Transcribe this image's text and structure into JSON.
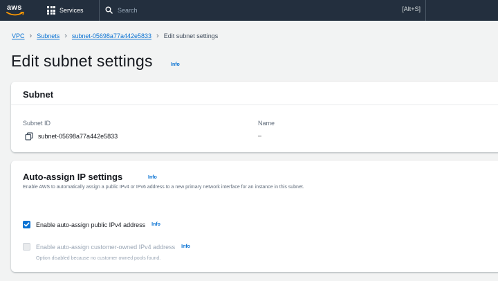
{
  "topnav": {
    "logo_text": "aws",
    "services_label": "Services",
    "search_placeholder": "Search",
    "shortcut": "[Alt+S]"
  },
  "breadcrumb": {
    "items": [
      "VPC",
      "Subnets",
      "subnet-05698a77a442e5833"
    ],
    "current": "Edit subnet settings"
  },
  "page": {
    "title": "Edit subnet settings",
    "info": "Info"
  },
  "subnet_panel": {
    "title": "Subnet",
    "subnet_id_label": "Subnet ID",
    "subnet_id_value": "subnet-05698a77a442e5833",
    "name_label": "Name",
    "name_value": "–"
  },
  "auto_assign_panel": {
    "title": "Auto-assign IP settings",
    "info": "Info",
    "description": "Enable AWS to automatically assign a public IPv4 or IPv6 address to a new primary network interface for an instance in this subnet.",
    "options": [
      {
        "label": "Enable auto-assign public IPv4 address",
        "info": "Info",
        "checked": true,
        "disabled": false
      },
      {
        "label": "Enable auto-assign customer-owned IPv4 address",
        "info": "Info",
        "checked": false,
        "disabled": true,
        "hint": "Option disabled because no customer owned pools found."
      }
    ]
  },
  "colors": {
    "nav_bg": "#232f3e",
    "link": "#0972d3",
    "aws_smile": "#ff9900"
  }
}
